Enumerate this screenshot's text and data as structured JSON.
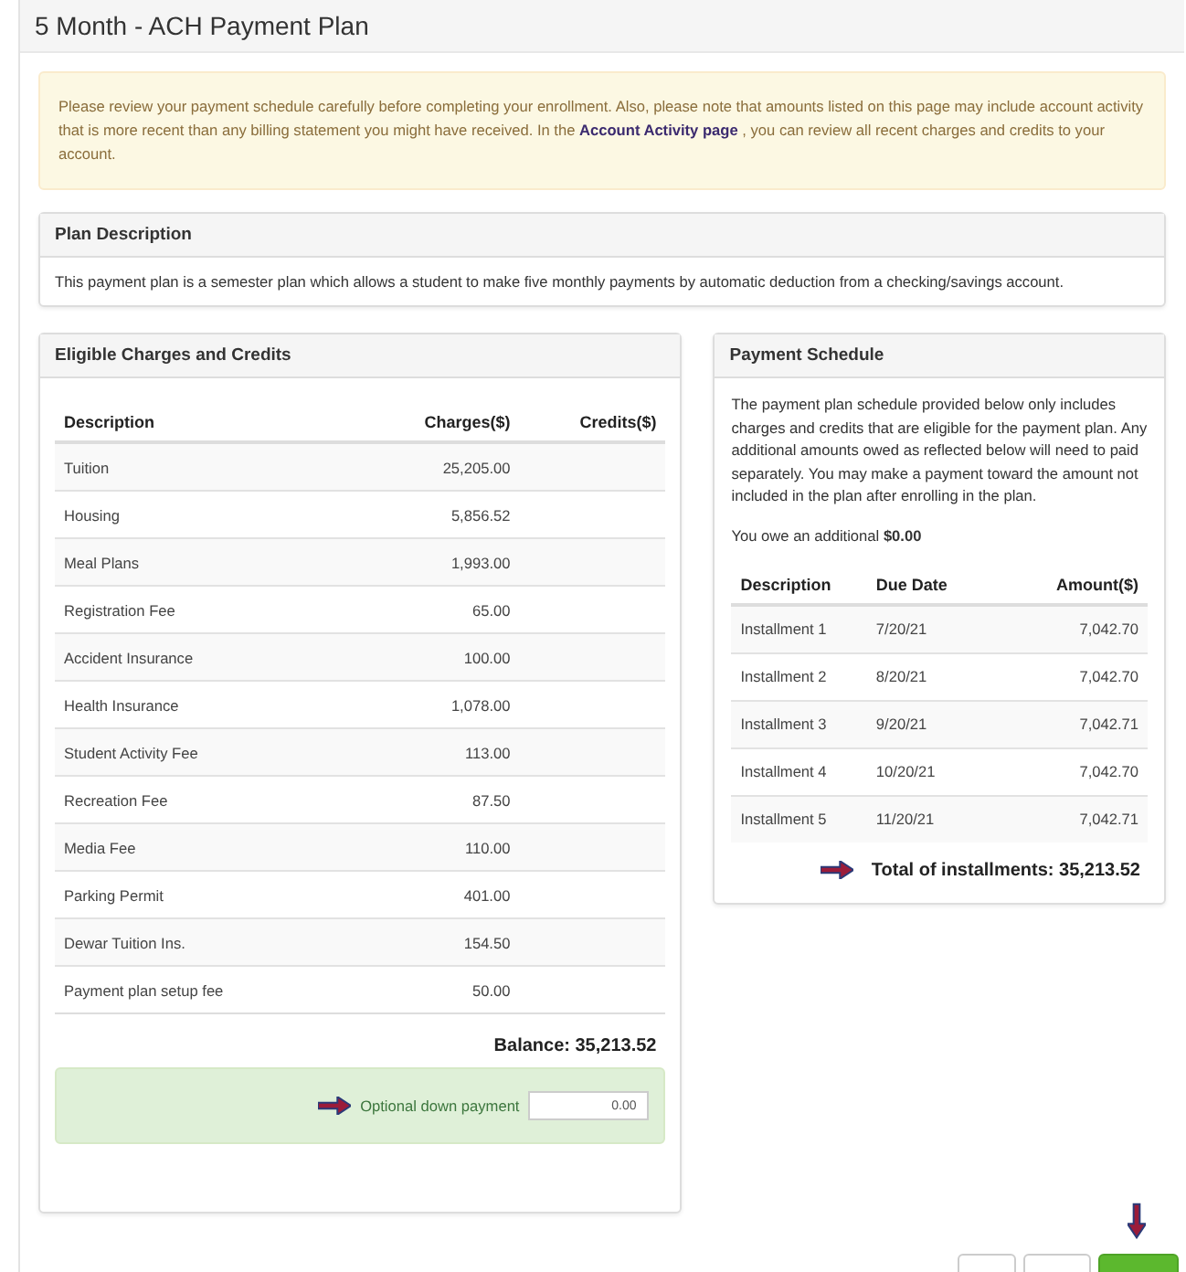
{
  "page_title": "5 Month - ACH Payment Plan",
  "notice": {
    "before": "Please review your payment schedule carefully before completing your enrollment. Also, please note that amounts listed on this page may include account activity that is more recent than any billing statement you might have received. In the ",
    "link": "Account Activity page",
    "after": " , you can review all recent charges and credits to your account."
  },
  "plan_description": {
    "title": "Plan Description",
    "text": "This payment plan is a semester plan which allows a student to make five monthly payments by automatic deduction from a checking/savings account."
  },
  "charges": {
    "title": "Eligible Charges and Credits",
    "columns": [
      "Description",
      "Charges($)",
      "Credits($)"
    ],
    "rows": [
      {
        "description": "Tuition",
        "charges": "25,205.00"
      },
      {
        "description": "Housing",
        "charges": "5,856.52"
      },
      {
        "description": "Meal Plans",
        "charges": "1,993.00"
      },
      {
        "description": "Registration Fee",
        "charges": "65.00"
      },
      {
        "description": "Accident Insurance",
        "charges": "100.00"
      },
      {
        "description": "Health Insurance",
        "charges": "1,078.00"
      },
      {
        "description": "Student Activity Fee",
        "charges": "113.00"
      },
      {
        "description": "Recreation Fee",
        "charges": "87.50"
      },
      {
        "description": "Media Fee",
        "charges": "110.00"
      },
      {
        "description": "Parking Permit",
        "charges": "401.00"
      },
      {
        "description": "Dewar Tuition Ins.",
        "charges": "154.50"
      },
      {
        "description": "Payment plan setup fee",
        "charges": "50.00"
      }
    ],
    "balance": "Balance: 35,213.52",
    "down_payment": {
      "label": "Optional down payment",
      "value": "0.00"
    }
  },
  "schedule": {
    "title": "Payment Schedule",
    "intro": "The payment plan schedule provided below only includes charges and credits that are eligible for the payment plan. Any additional amounts owed as reflected below will need to paid separately. You may make a payment toward the amount not included in the plan after enrolling in the plan.",
    "owe": "You owe an additional **$0.00**",
    "columns": [
      "Description",
      "Due Date",
      "Amount($)"
    ],
    "rows": [
      {
        "description": "Installment 1",
        "due": "7/20/21",
        "amount": "7,042.70"
      },
      {
        "description": "Installment 2",
        "due": "8/20/21",
        "amount": "7,042.70"
      },
      {
        "description": "Installment 3",
        "due": "9/20/21",
        "amount": "7,042.71"
      },
      {
        "description": "Installment 4",
        "due": "10/20/21",
        "amount": "7,042.70"
      },
      {
        "description": "Installment 5",
        "due": "11/20/21",
        "amount": "7,042.71"
      }
    ],
    "total": "Total of installments: 35,213.52"
  },
  "buttons": [
    {
      "kind": "default"
    },
    {
      "kind": "default"
    },
    {
      "kind": "primary"
    }
  ]
}
